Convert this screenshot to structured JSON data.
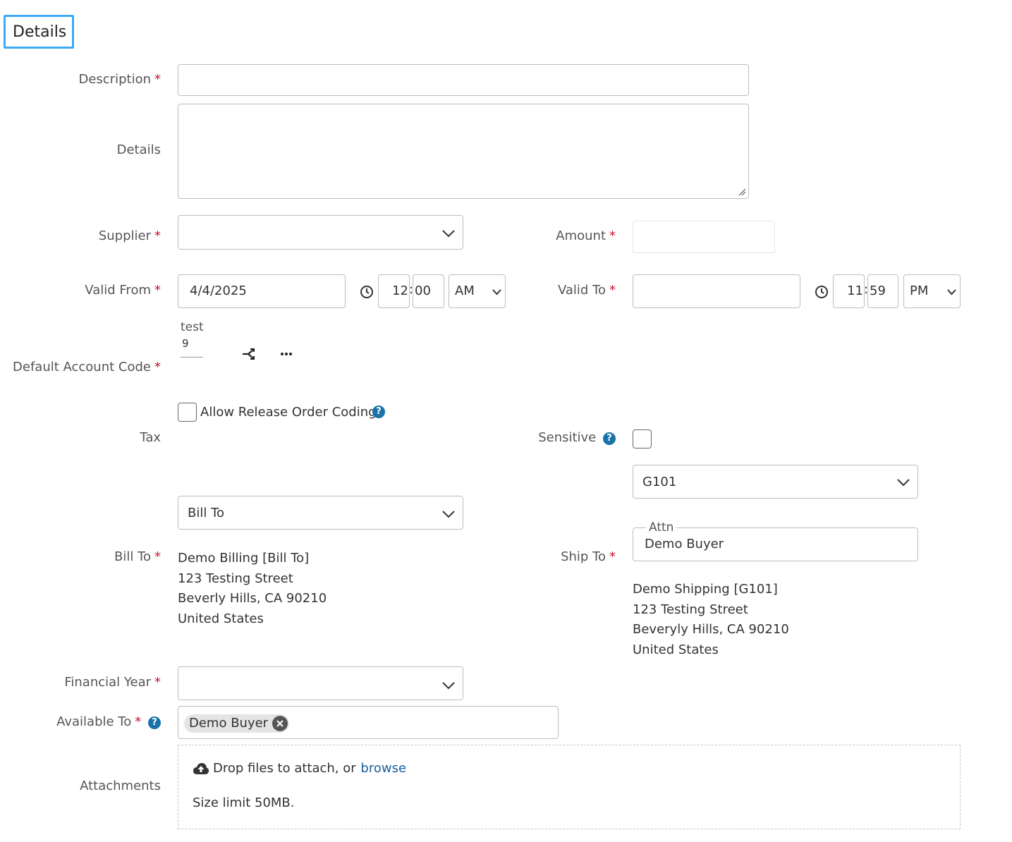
{
  "section": {
    "title": "Details"
  },
  "description": {
    "label": "Description",
    "value": ""
  },
  "details": {
    "label": "Details",
    "value": ""
  },
  "supplier": {
    "label": "Supplier",
    "value": ""
  },
  "amount": {
    "label": "Amount",
    "value": ""
  },
  "valid_from": {
    "label": "Valid From",
    "date": "4/4/2025",
    "hour": "12",
    "minute": "00",
    "ampm": "AM"
  },
  "valid_to": {
    "label": "Valid To",
    "date": "",
    "hour": "11",
    "minute": "59",
    "ampm": "PM"
  },
  "default_account_code": {
    "label": "Default Account Code",
    "segment_name": "test",
    "segment_value": "9"
  },
  "release_order_coding": {
    "label": "Allow Release Order Coding",
    "checked": false
  },
  "tax": {
    "label": "Tax"
  },
  "sensitive": {
    "label": "Sensitive",
    "checked": false
  },
  "ship_to_select": {
    "value": "G101"
  },
  "bill_to_select": {
    "value": "Bill To"
  },
  "bill_to": {
    "label": "Bill To",
    "address": [
      "Demo Billing [Bill To]",
      "123 Testing Street",
      "Beverly Hills, CA 90210",
      "United States"
    ]
  },
  "ship_to": {
    "label": "Ship To",
    "attn_label": "Attn",
    "attn_value": "Demo Buyer",
    "address": [
      "Demo Shipping [G101]",
      "123 Testing Street",
      "Beveryly Hills, CA 90210",
      "United States"
    ]
  },
  "financial_year": {
    "label": "Financial Year",
    "value": ""
  },
  "available_to": {
    "label": "Available To",
    "tags": [
      "Demo Buyer"
    ]
  },
  "attachments": {
    "label": "Attachments",
    "drop_text": "Drop files to attach, or",
    "browse_link": "browse",
    "size_limit": "Size limit 50MB."
  },
  "required_marker": "*",
  "help_glyph": "?",
  "icons": [
    "clock-icon",
    "chevron-down-icon",
    "split-icon",
    "more-icon",
    "help-icon",
    "close-icon",
    "cloud-upload-icon"
  ],
  "colors": {
    "accent": "#3fa9f5",
    "required": "#c8102e",
    "link": "#1a5f9c",
    "help": "#1a73a8"
  }
}
